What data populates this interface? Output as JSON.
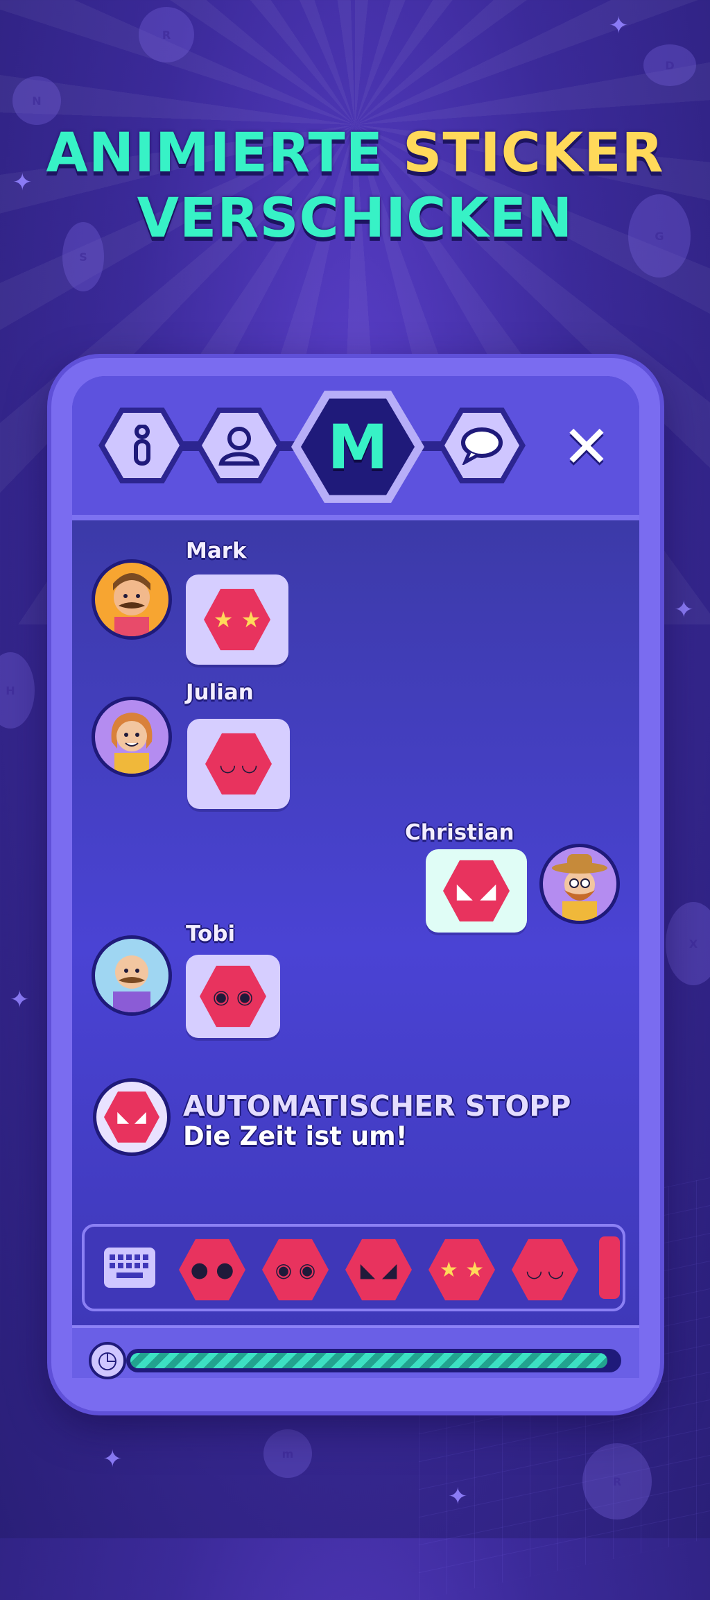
{
  "headline": {
    "line1_teal": "ANIMIERTE",
    "line1_yellow": "STICKER",
    "line2": "VERSCHICKEN"
  },
  "tabs": [
    {
      "icon": "info-icon",
      "label": "i"
    },
    {
      "icon": "user-icon"
    },
    {
      "icon": "letter-m-icon",
      "label": "M"
    },
    {
      "icon": "chat-bubble-icon"
    }
  ],
  "close_label": "✕",
  "messages": [
    {
      "name": "Mark",
      "sticker": "star-eyes",
      "side": "left"
    },
    {
      "name": "Julian",
      "sticker": "party",
      "side": "left"
    },
    {
      "name": "Christian",
      "sticker": "angry",
      "side": "right"
    },
    {
      "name": "Tobi",
      "sticker": "silly",
      "side": "left"
    }
  ],
  "system": {
    "title": "AUTOMATISCHER STOPP",
    "subtitle": "Die Zeit ist um!"
  },
  "tray_stickers": [
    "surprised",
    "silly",
    "angry",
    "star-eyes",
    "party"
  ],
  "timer": {
    "remaining_fraction": 0.98
  },
  "colors": {
    "teal": "#37f2c6",
    "yellow": "#ffd95a",
    "sticker_red": "#e8335e",
    "panel": "#4b3fcf"
  }
}
